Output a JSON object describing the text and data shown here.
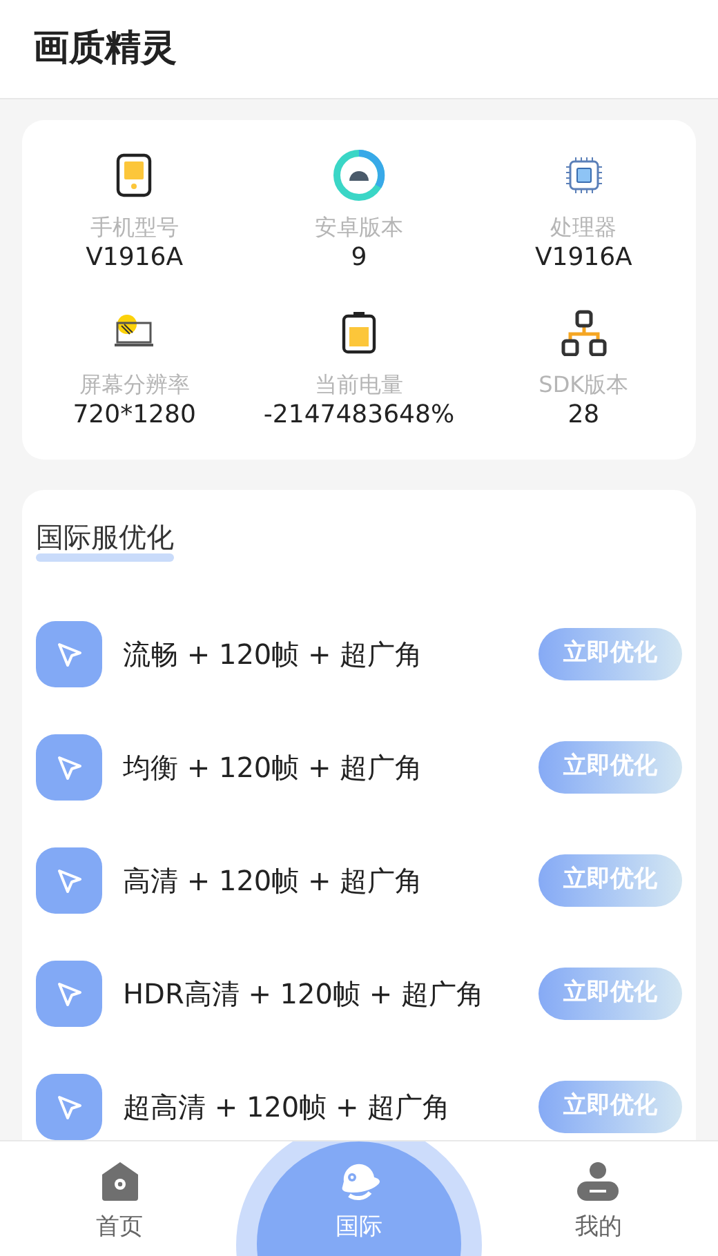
{
  "header": {
    "title": "画质精灵"
  },
  "device_info": [
    {
      "kind": "phone",
      "label": "手机型号",
      "value": "V1916A"
    },
    {
      "kind": "android",
      "label": "安卓版本",
      "value": "9"
    },
    {
      "kind": "cpu",
      "label": "处理器",
      "value": "V1916A"
    },
    {
      "kind": "screen",
      "label": "屏幕分辨率",
      "value": "720*1280"
    },
    {
      "kind": "battery",
      "label": "当前电量",
      "value": "-2147483648%"
    },
    {
      "kind": "network",
      "label": "SDK版本",
      "value": "28"
    }
  ],
  "optimize": {
    "title": "国际服优化",
    "items": [
      {
        "label": "流畅 + 120帧 + 超广角",
        "button": "立即优化"
      },
      {
        "label": "均衡 + 120帧 + 超广角",
        "button": "立即优化"
      },
      {
        "label": "高清 + 120帧 + 超广角",
        "button": "立即优化"
      },
      {
        "label": "HDR高清 + 120帧 + 超广角",
        "button": "立即优化"
      },
      {
        "label": "超高清 + 120帧 + 超广角",
        "button": "立即优化"
      }
    ]
  },
  "bottom_nav": [
    {
      "kind": "home",
      "label": "首页",
      "selected": false
    },
    {
      "kind": "planet",
      "label": "国际",
      "selected": true
    },
    {
      "kind": "user",
      "label": "我的",
      "selected": false
    }
  ]
}
